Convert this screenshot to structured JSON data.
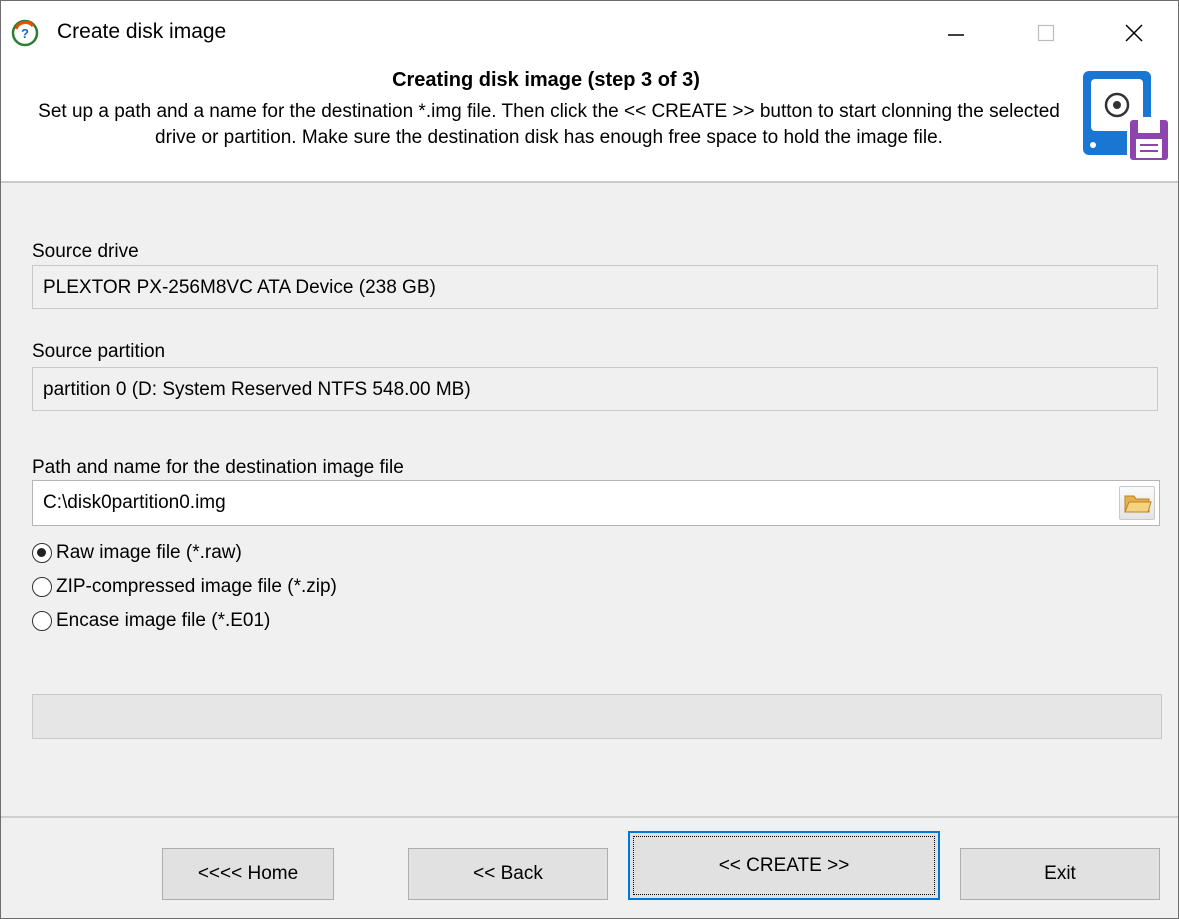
{
  "window": {
    "title": "Create disk image"
  },
  "header": {
    "title": "Creating disk image (step 3 of 3)",
    "description": "Set up a path and a name for the destination *.img file. Then click the << CREATE >> button to start clonning the selected drive or partition. Make sure the destination disk has enough free space to hold the image file."
  },
  "source_drive": {
    "label": "Source drive",
    "value": "PLEXTOR PX-256M8VC ATA Device (238 GB)"
  },
  "source_partition": {
    "label": "Source partition",
    "value": "partition 0 (D: System Reserved NTFS 548.00 MB)"
  },
  "destination": {
    "label": "Path and name for the destination image file",
    "value": "C:\\disk0partition0.img"
  },
  "format_options": [
    {
      "label": "Raw image file (*.raw)",
      "checked": true
    },
    {
      "label": "ZIP-compressed image file (*.zip)",
      "checked": false
    },
    {
      "label": "Encase image file (*.E01)",
      "checked": false
    }
  ],
  "progress": {
    "fraction": 0
  },
  "buttons": {
    "home": "<<<< Home",
    "back": "<< Back",
    "create": "<< CREATE >>",
    "exit": "Exit"
  },
  "icons": {
    "app": "app-logo-icon",
    "header": "disk-save-icon",
    "browse": "folder-icon"
  },
  "colors": {
    "accent": "#0078d7",
    "disk_blue": "#1976d2",
    "floppy_purple": "#8e44ad"
  }
}
